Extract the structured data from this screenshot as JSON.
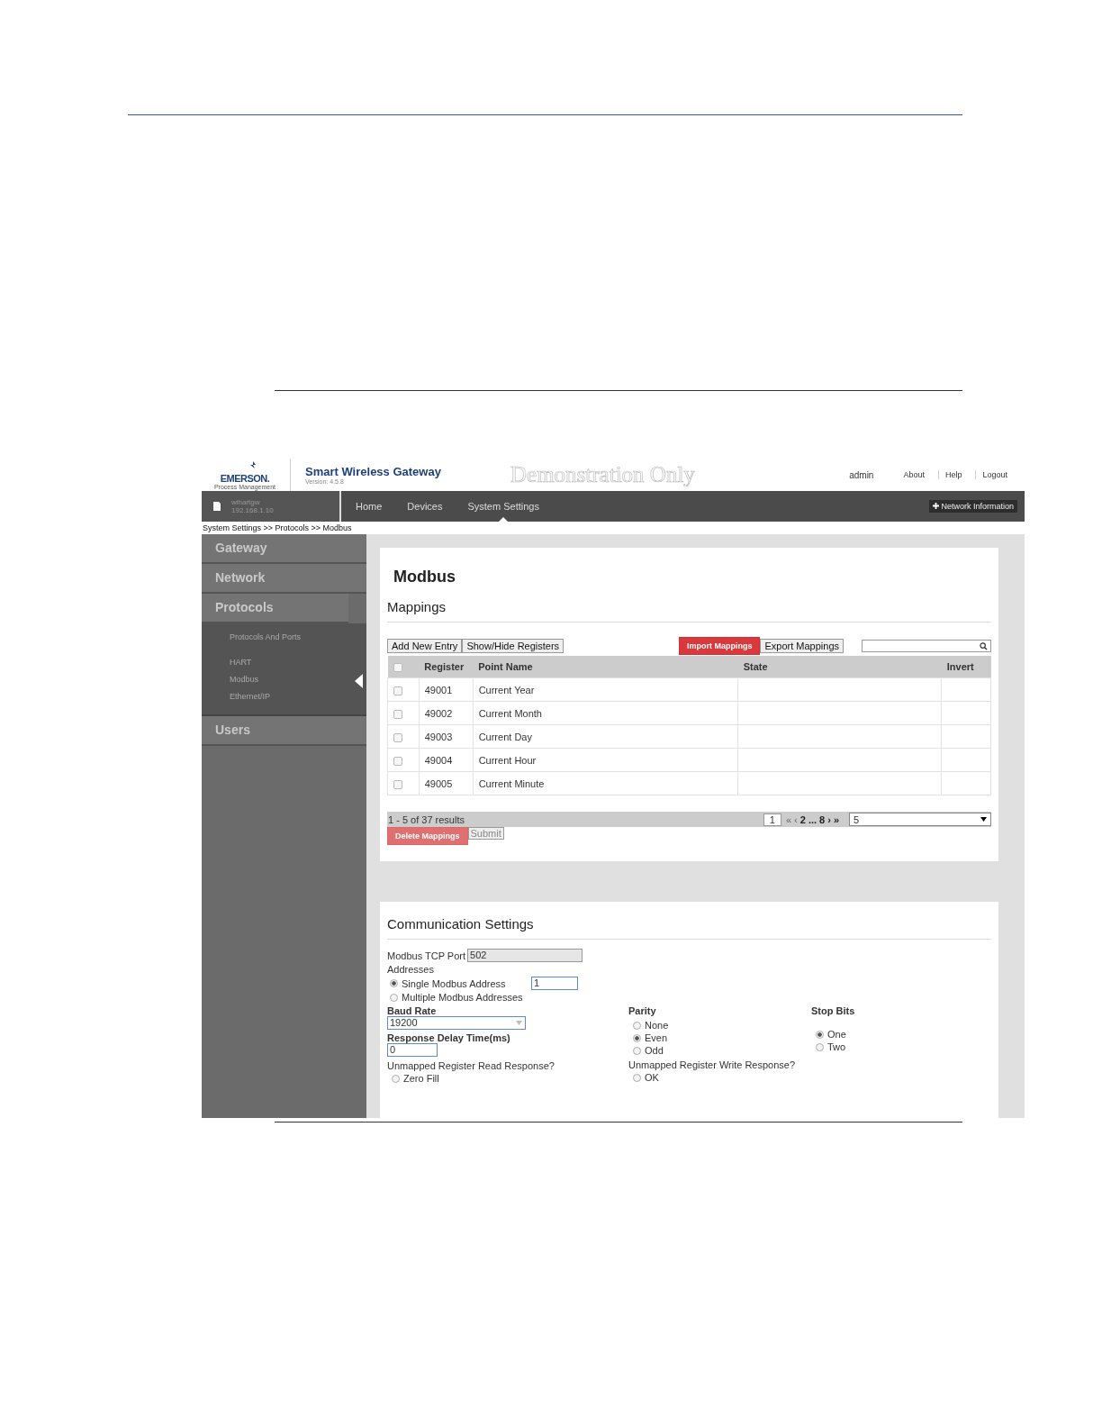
{
  "header": {
    "logo_text": "EMERSON.",
    "logo_subtext": "Process Management",
    "product_title": "Smart Wireless Gateway",
    "version": "Version: 4.5.8",
    "demo_banner": "Demonstration Only",
    "user": "admin",
    "links": [
      "About",
      "Help",
      "Logout"
    ]
  },
  "navbar": {
    "device_name": "wihartgw",
    "device_ip": "192.168.1.10",
    "items": [
      {
        "label": "Home",
        "selected": false
      },
      {
        "label": "Devices",
        "selected": false
      },
      {
        "label": "System Settings",
        "selected": true
      }
    ],
    "network_button": "Network Information"
  },
  "breadcrumb": "System Settings >> Protocols >> Modbus",
  "sidebar": {
    "items": [
      {
        "label": "Gateway",
        "expanded": false
      },
      {
        "label": "Network",
        "expanded": false
      },
      {
        "label": "Protocols",
        "expanded": true,
        "children": [
          {
            "label": "Protocols And Ports",
            "selected": false
          },
          {
            "label": "HART",
            "selected": false
          },
          {
            "label": "Modbus",
            "selected": true
          },
          {
            "label": "Ethernet/IP",
            "selected": false
          }
        ]
      },
      {
        "label": "Users",
        "expanded": false
      }
    ]
  },
  "modbus_panel": {
    "title": "Modbus",
    "section": "Mappings",
    "toolbar_buttons": [
      "Add New Entry",
      "Show/Hide Registers"
    ],
    "import_button": "Import Mappings",
    "export_button": "Export Mappings",
    "table": {
      "columns": [
        "Register",
        "Point Name",
        "State",
        "Invert"
      ],
      "header_checked": false,
      "rows": [
        {
          "checked": false,
          "register": "49001",
          "point_name": "Current Year"
        },
        {
          "checked": false,
          "register": "49002",
          "point_name": "Current Month"
        },
        {
          "checked": false,
          "register": "49003",
          "point_name": "Current Day"
        },
        {
          "checked": false,
          "register": "49004",
          "point_name": "Current Hour"
        },
        {
          "checked": false,
          "register": "49005",
          "point_name": "Current Minute"
        }
      ]
    },
    "pager": {
      "summary": "1 - 5 of 37 results",
      "current_page": "1",
      "links": [
        {
          "label": "«",
          "disabled": true
        },
        {
          "label": "‹",
          "disabled": true
        },
        {
          "label": "2",
          "disabled": false
        },
        {
          "label": "...",
          "disabled": false
        },
        {
          "label": "8",
          "disabled": false
        },
        {
          "label": "›",
          "disabled": false
        },
        {
          "label": "»",
          "disabled": false
        }
      ],
      "page_size": "5"
    },
    "delete_button": "Delete Mappings",
    "submit_button": "Submit"
  },
  "comm_panel": {
    "title": "Communication Settings",
    "tcp_port_label": "Modbus TCP Port",
    "tcp_port": "502",
    "addresses_label": "Addresses",
    "addresses": [
      {
        "label": "Single Modbus Address",
        "selected": true,
        "value": "1"
      },
      {
        "label": "Multiple Modbus Addresses",
        "selected": false
      }
    ],
    "baud_rate_label": "Baud Rate",
    "baud_rate": "19200",
    "delay_label": "Response Delay Time(ms)",
    "delay": "0",
    "parity_label": "Parity",
    "parity": [
      {
        "label": "None",
        "selected": false
      },
      {
        "label": "Even",
        "selected": true
      },
      {
        "label": "Odd",
        "selected": false
      }
    ],
    "stop_bits_label": "Stop Bits",
    "stop_bits": [
      {
        "label": "One",
        "selected": true
      },
      {
        "label": "Two",
        "selected": false
      }
    ],
    "read_response_label": "Unmapped Register Read Response?",
    "read_response": [
      {
        "label": "Zero Fill",
        "selected": false
      }
    ],
    "write_response_label": "Unmapped Register Write Response?",
    "write_response": [
      {
        "label": "OK",
        "selected": false
      }
    ]
  }
}
